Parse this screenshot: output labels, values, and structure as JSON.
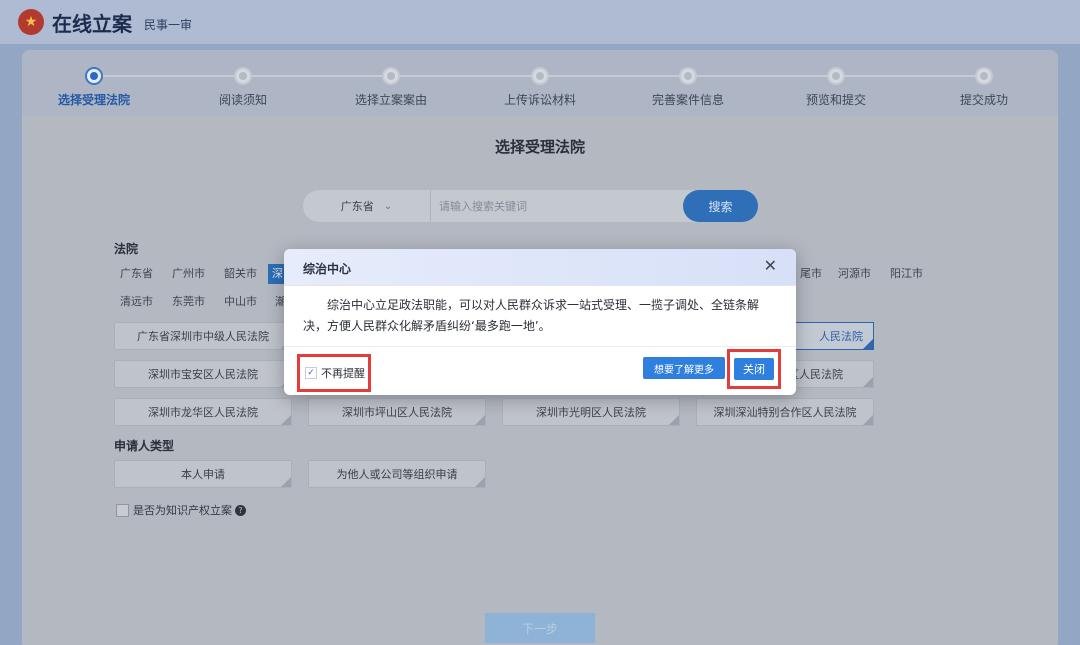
{
  "header": {
    "title": "在线立案",
    "subtitle": "民事一审",
    "emblem_icon": "court-emblem-icon"
  },
  "steps": [
    {
      "label": "选择受理法院",
      "active": true
    },
    {
      "label": "阅读须知"
    },
    {
      "label": "选择立案案由"
    },
    {
      "label": "上传诉讼材料"
    },
    {
      "label": "完善案件信息"
    },
    {
      "label": "预览和提交"
    },
    {
      "label": "提交成功"
    }
  ],
  "page": {
    "title": "选择受理法院"
  },
  "search": {
    "province": "广东省",
    "placeholder": "请输入搜索关键词",
    "button": "搜索"
  },
  "court_section": {
    "label": "法院",
    "cities_row1": [
      "广东省",
      "广州市",
      "韶关市",
      "深",
      "尾市",
      "河源市",
      "阳江市"
    ],
    "cities_row2": [
      "清远市",
      "东莞市",
      "中山市",
      "潮"
    ],
    "courts": [
      "广东省深圳市中级人民法院",
      "人民法院",
      "深圳市宝安区人民法院",
      "区人民法院",
      "深圳市龙华区人民法院",
      "深圳市坪山区人民法院",
      "深圳市光明区人民法院",
      "深圳深汕特别合作区人民法院"
    ]
  },
  "applicant_section": {
    "label": "申请人类型",
    "options": [
      "本人申请",
      "为他人或公司等组织申请"
    ]
  },
  "ip_checkbox": {
    "label": "是否为知识产权立案",
    "help": "?"
  },
  "next_button": "下一步",
  "modal": {
    "title": "综治中心",
    "close_glyph": "✕",
    "body": "综治中心立足政法职能，可以对人民群众诉求一站式受理、一揽子调处、全链条解决，方便人民群众化解矛盾纠纷‘最多跑一地’。",
    "dont_remind": "不再提醒",
    "dont_remind_checked": true,
    "learn_more": "想要了解更多",
    "close": "关闭"
  },
  "colors": {
    "primary": "#2f7fdf",
    "highlight_box": "#e43b3b"
  }
}
